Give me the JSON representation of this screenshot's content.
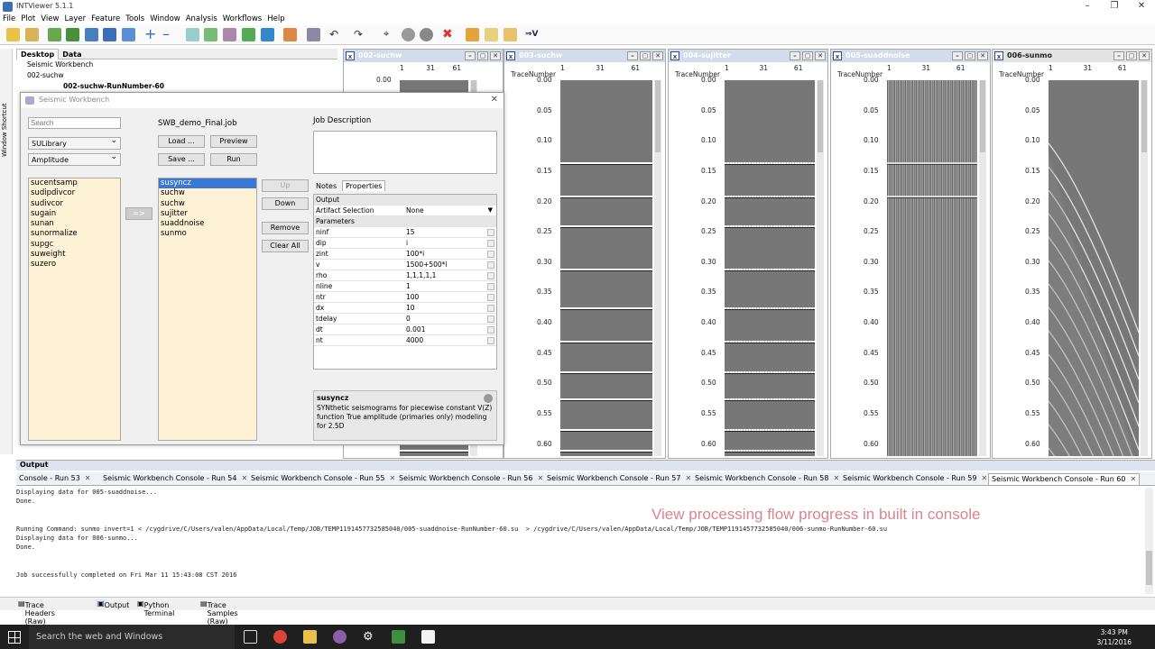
{
  "app": {
    "title": "INTViewer 5.1.1",
    "menus": [
      "File",
      "Plot",
      "View",
      "Layer",
      "Feature",
      "Tools",
      "Window",
      "Analysis",
      "Workflows",
      "Help"
    ]
  },
  "left_panel": {
    "tabs": [
      "Desktop",
      "Data"
    ],
    "tree": [
      "Seismic Workbench",
      "002-suchw",
      "002-suchw-RunNumber-60"
    ],
    "shortcut_label": "Window Shortcut"
  },
  "dialog": {
    "title": "Seismic Workbench",
    "search_placeholder": "Search",
    "library": "SULibrary",
    "category": "Amplitude",
    "job_file": "SWB_demo_Final.job",
    "buttons": {
      "load": "Load ...",
      "preview": "Preview",
      "save": "Save ...",
      "run": "Run",
      "up": "Up",
      "down": "Down",
      "remove": "Remove",
      "clear_all": "Clear All",
      "add": "=>"
    },
    "available_modules": [
      "sucentsamp",
      "sudipdivcor",
      "sudivcor",
      "sugain",
      "sunan",
      "sunormalize",
      "supgc",
      "suweight",
      "suzero"
    ],
    "job_modules": [
      "susyncz",
      "suchw",
      "suchw",
      "sujitter",
      "suaddnoise",
      "sunmo"
    ],
    "job_description_label": "Job Description",
    "prop_tabs": [
      "Notes",
      "Properties"
    ],
    "sections": {
      "output": "Output",
      "parameters": "Parameters"
    },
    "artifact": {
      "label": "Artifact Selection",
      "value": "None"
    },
    "params": [
      {
        "k": "ninf",
        "v": "15"
      },
      {
        "k": "dip",
        "v": "i"
      },
      {
        "k": "zint",
        "v": "100*i"
      },
      {
        "k": "v",
        "v": "1500+500*i"
      },
      {
        "k": "rho",
        "v": "1,1,1,1,1"
      },
      {
        "k": "nline",
        "v": "1"
      },
      {
        "k": "ntr",
        "v": "100"
      },
      {
        "k": "dx",
        "v": "10"
      },
      {
        "k": "tdelay",
        "v": "0"
      },
      {
        "k": "dt",
        "v": "0.001"
      },
      {
        "k": "nt",
        "v": "4000"
      }
    ],
    "desc_title": "susyncz",
    "desc_text": "SYNthetic seismograms for piecewise constant V(Z) function True amplitude (primaries only) modeling for 2.5D"
  },
  "viewers": [
    {
      "title": "002-suchw",
      "style": "clean"
    },
    {
      "title": "003-suchw",
      "style": "clean"
    },
    {
      "title": "004-sujitter",
      "style": "jitter"
    },
    {
      "title": "005-suaddnoise",
      "style": "noise"
    },
    {
      "title": "006-sunmo",
      "style": "nmo"
    }
  ],
  "axis": {
    "trace_label": "TraceNumber",
    "trace_ticks": [
      "1",
      "31",
      "61"
    ],
    "time_ticks": [
      "0.00",
      "0.05",
      "0.10",
      "0.15",
      "0.20",
      "0.25",
      "0.30",
      "0.35",
      "0.40",
      "0.45",
      "0.50",
      "0.55",
      "0.60"
    ]
  },
  "output": {
    "header": "Output",
    "tabs": [
      "Console - Run 53",
      "Seismic Workbench Console - Run 54",
      "Seismic Workbench Console - Run 55",
      "Seismic Workbench Console - Run 56",
      "Seismic Workbench Console - Run 57",
      "Seismic Workbench Console - Run 58",
      "Seismic Workbench Console - Run 59",
      "Seismic Workbench Console - Run 60"
    ],
    "console": [
      "Displaying data for 005-suaddnoise...",
      "Done.",
      "",
      "",
      "Running Command: sunmo invert=1 < /cygdrive/C/Users/valen/AppData/Local/Temp/JOB/TEMP1191457732585040/005-suaddnoise-RunNumber-60.su  > /cygdrive/C/Users/valen/AppData/Local/Temp/JOB/TEMP1191457732585040/006-sunmo-RunNumber-60.su",
      "Displaying data for 006-sunmo...",
      "Done.",
      "",
      "",
      "Job successfully completed on Fri Mar 11 15:43:08 CST 2016"
    ],
    "overlay": "View processing flow progress in built in console"
  },
  "bottom_tabs": [
    "Trace Headers (Raw)",
    "Output",
    "Python Terminal",
    "Trace Samples (Raw)"
  ],
  "taskbar": {
    "search": "Search the web and Windows",
    "time": "3:43 PM",
    "date": "3/11/2016"
  }
}
